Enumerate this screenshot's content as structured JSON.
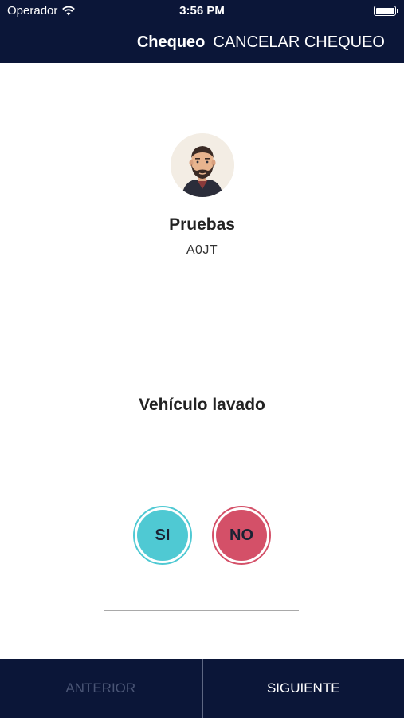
{
  "status_bar": {
    "carrier": "Operador",
    "time": "3:56 PM",
    "wifi_icon": "wifi-icon",
    "battery_icon": "battery-icon"
  },
  "nav": {
    "title": "Chequeo",
    "cancel_label": "CANCELAR CHEQUEO"
  },
  "profile": {
    "avatar_icon": "man-avatar",
    "name": "Pruebas",
    "code": "A0JT"
  },
  "question": {
    "text": "Vehículo lavado",
    "yes_label": "SI",
    "no_label": "NO"
  },
  "colors": {
    "bar_background": "#0b1638",
    "yes": "#4fc9d3",
    "no": "#d45068"
  },
  "footer": {
    "previous_label": "ANTERIOR",
    "next_label": "SIGUIENTE"
  }
}
